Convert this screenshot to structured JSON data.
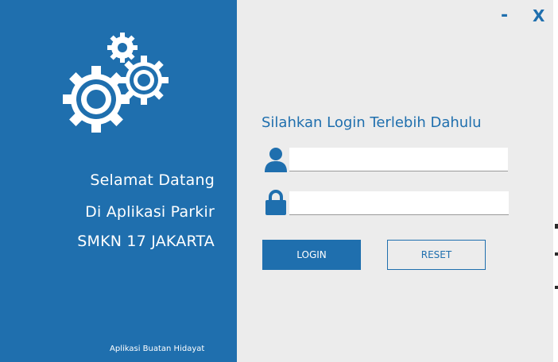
{
  "window": {
    "minimize_label": "-",
    "close_label": "X"
  },
  "left_panel": {
    "welcome_line1": "Selamat Datang",
    "welcome_line2": "Di Aplikasi Parkir",
    "welcome_line3": "SMKN 17 JAKARTA",
    "credit": "Aplikasi Buatan Hidayat",
    "logo_icon": "gears-icon"
  },
  "login_form": {
    "prompt": "Silahkan Login Terlebih Dahulu",
    "username_value": "",
    "password_value": "",
    "username_icon": "user-icon",
    "password_icon": "lock-icon",
    "login_label": "LOGIN",
    "reset_label": "RESET"
  },
  "colors": {
    "brand_blue": "#1f6fae",
    "panel_background": "#ececec",
    "text_light": "#ffffff"
  }
}
